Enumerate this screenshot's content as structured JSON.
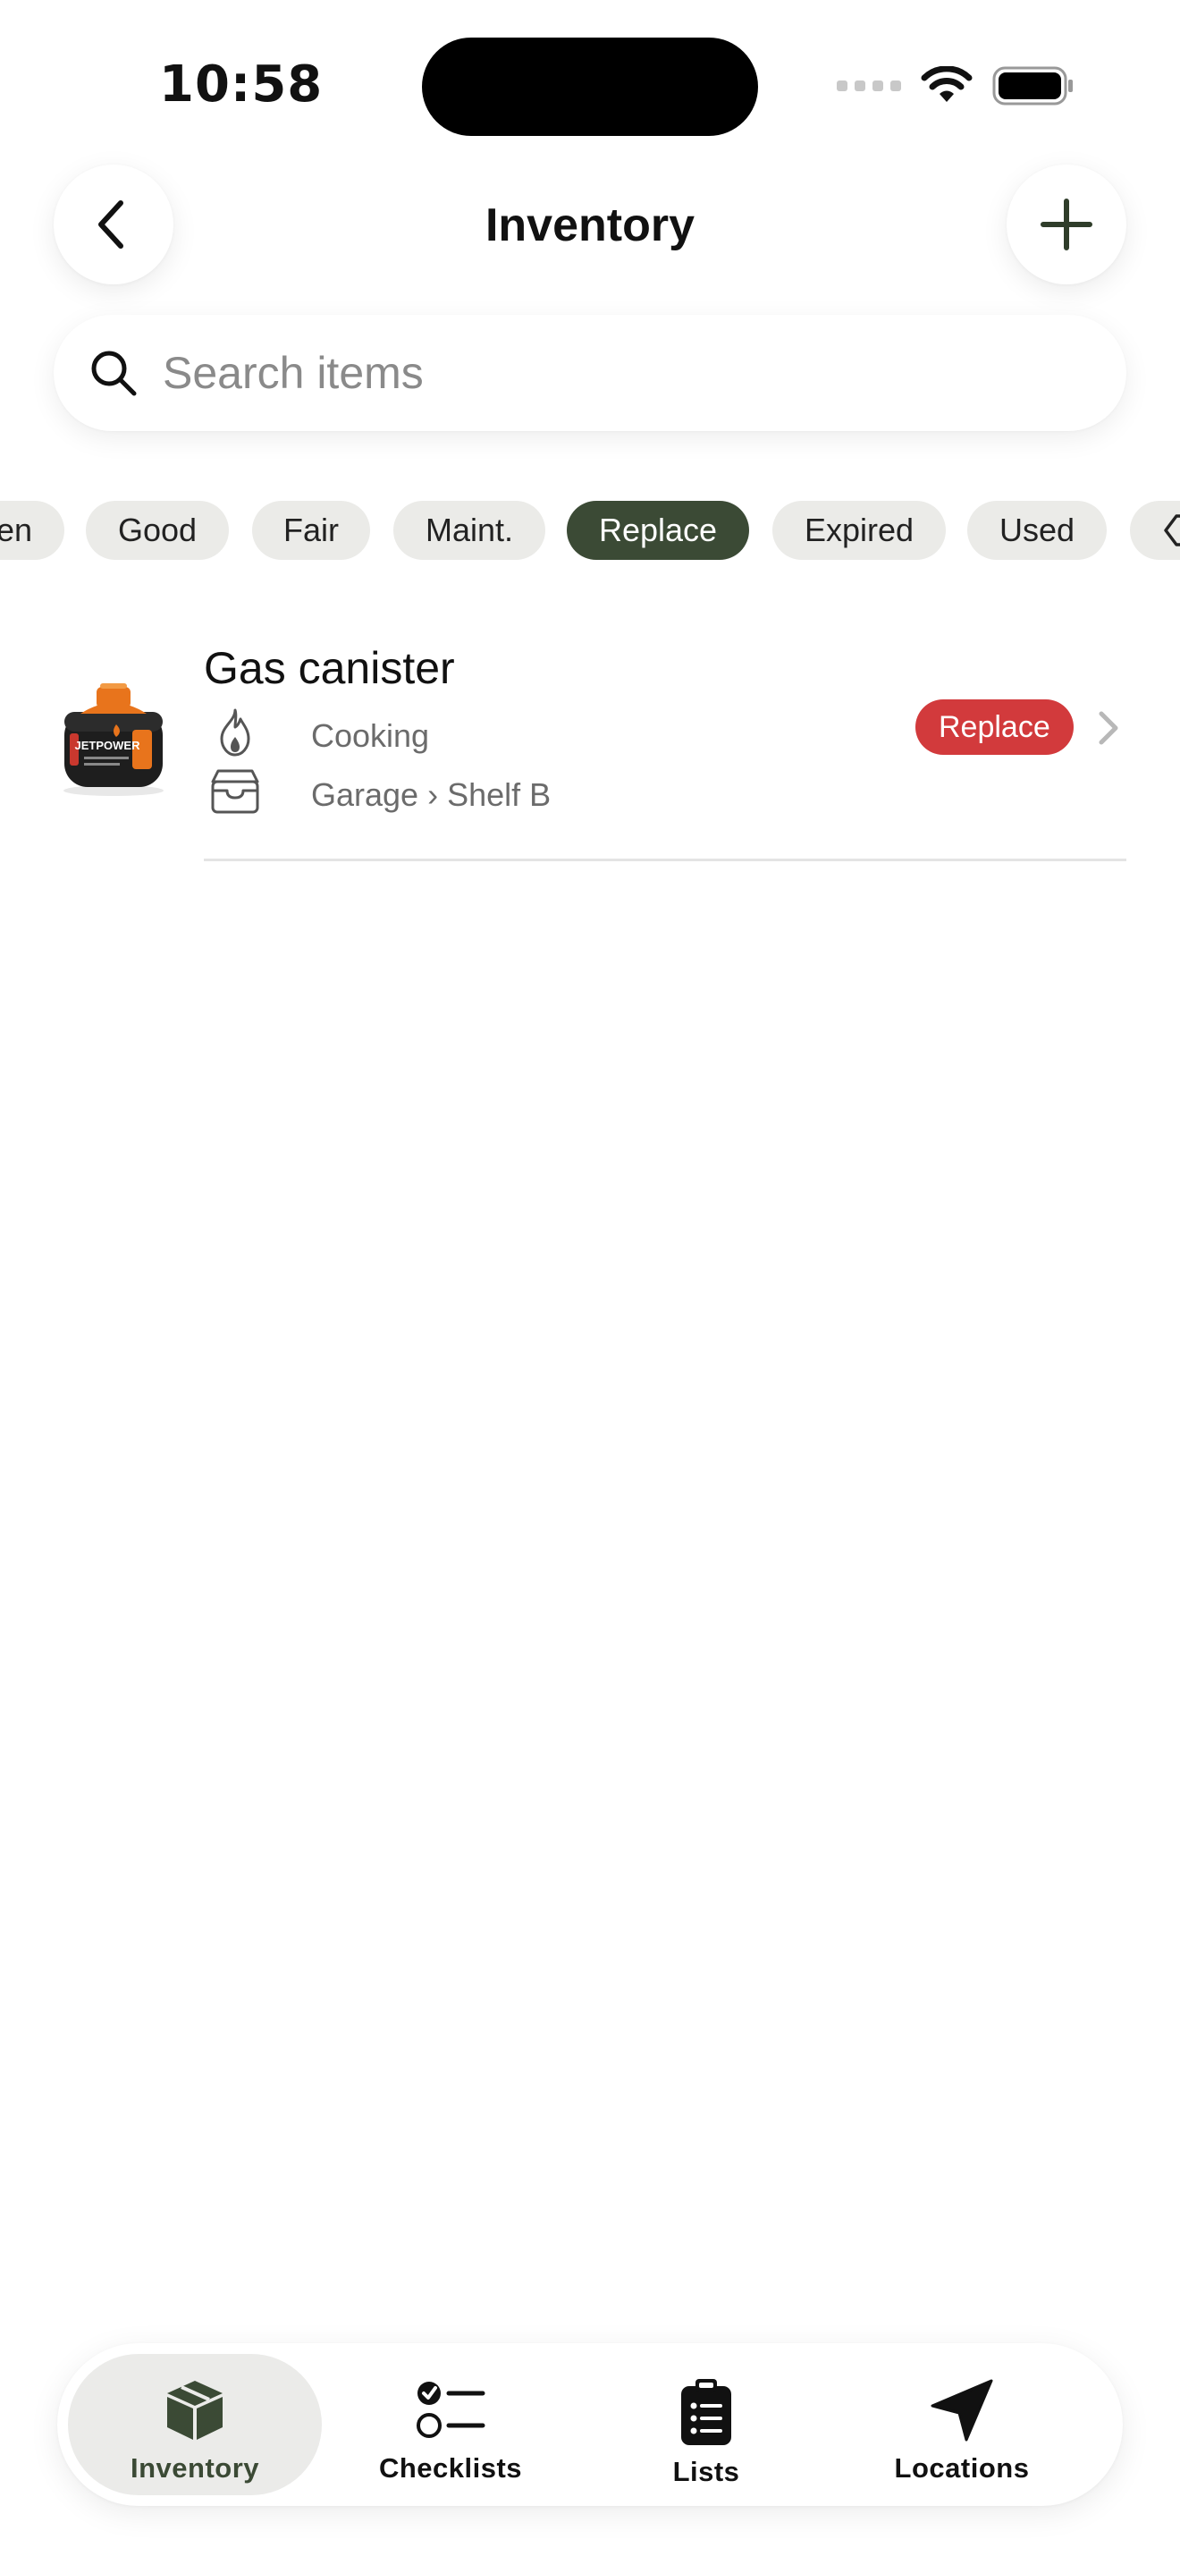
{
  "status_bar": {
    "time": "10:58"
  },
  "header": {
    "title": "Inventory"
  },
  "search": {
    "placeholder": "Search items"
  },
  "filters": {
    "chips": [
      {
        "label": "en"
      },
      {
        "label": "Good"
      },
      {
        "label": "Fair"
      },
      {
        "label": "Maint."
      },
      {
        "label": "Replace",
        "selected": true
      },
      {
        "label": "Expired"
      },
      {
        "label": "Used"
      }
    ]
  },
  "items": [
    {
      "name": "Gas canister",
      "image_label": "JETPOWER",
      "category": "Cooking",
      "location": "Garage › Shelf B",
      "status": "Replace",
      "status_color": "#d23a3c"
    }
  ],
  "tabs": [
    {
      "label": "Inventory",
      "icon": "box-icon",
      "active": true
    },
    {
      "label": "Checklists",
      "icon": "checklist-icon"
    },
    {
      "label": "Lists",
      "icon": "clipboard-icon"
    },
    {
      "label": "Locations",
      "icon": "location-arrow-icon"
    }
  ],
  "colors": {
    "accent": "#3b4a35",
    "status_replace": "#d23a3c",
    "chip_bg": "#ebebe8"
  }
}
